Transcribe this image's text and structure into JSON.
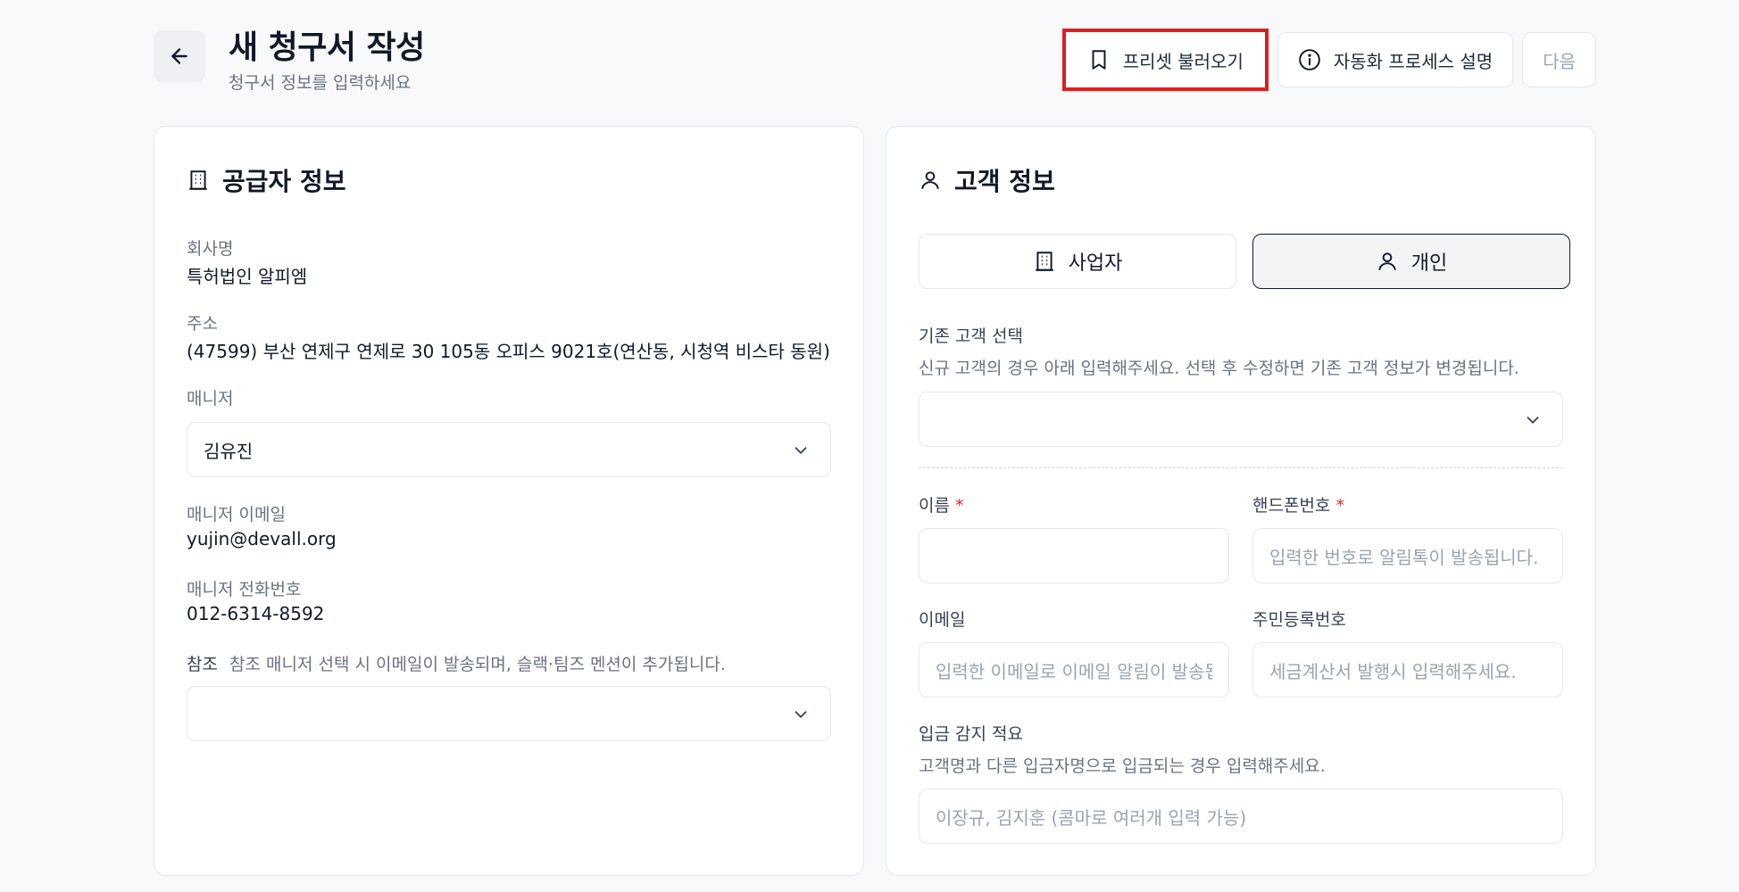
{
  "header": {
    "title": "새 청구서 작성",
    "subtitle": "청구서 정보를 입력하세요",
    "actions": {
      "load_preset": "프리셋 불러오기",
      "automation_info": "자동화 프로세스 설명",
      "next": "다음"
    }
  },
  "supplier": {
    "title": "공급자 정보",
    "company_label": "회사명",
    "company_value": "특허법인 알피엠",
    "address_label": "주소",
    "address_value": "(47599) 부산 연제구 연제로 30 105동 오피스 9021호(연산동, 시청역 비스타 동원)",
    "manager_label": "매니저",
    "manager_value": "김유진",
    "manager_email_label": "매니저 이메일",
    "manager_email_value": "yujin@devall.org",
    "manager_phone_label": "매니저 전화번호",
    "manager_phone_value": "012-6314-8592",
    "cc_label": "참조",
    "cc_hint": "참조 매니저 선택 시 이메일이 발송되며, 슬랙·팀즈 멘션이 추가됩니다.",
    "cc_value": ""
  },
  "customer": {
    "title": "고객 정보",
    "type_business": "사업자",
    "type_individual": "개인",
    "existing_label": "기존 고객 선택",
    "existing_hint": "신규 고객의 경우 아래 입력해주세요. 선택 후 수정하면 기존 고객 정보가 변경됩니다.",
    "existing_value": "",
    "name_label": "이름",
    "name_value": "",
    "phone_label": "핸드폰번호",
    "phone_placeholder": "입력한 번호로 알림톡이 발송됩니다.",
    "email_label": "이메일",
    "email_placeholder": "입력한 이메일로 이메일 알림이 발송됩니다.",
    "rrn_label": "주민등록번호",
    "rrn_placeholder": "세금계산서 발행시 입력해주세요.",
    "deposit_label": "입금 감지 적요",
    "deposit_hint": "고객명과 다른 입금자명으로 입금되는 경우 입력해주세요.",
    "deposit_placeholder": "이장규, 김지훈 (콤마로 여러개 입력 가능)",
    "required_mark": "*"
  }
}
